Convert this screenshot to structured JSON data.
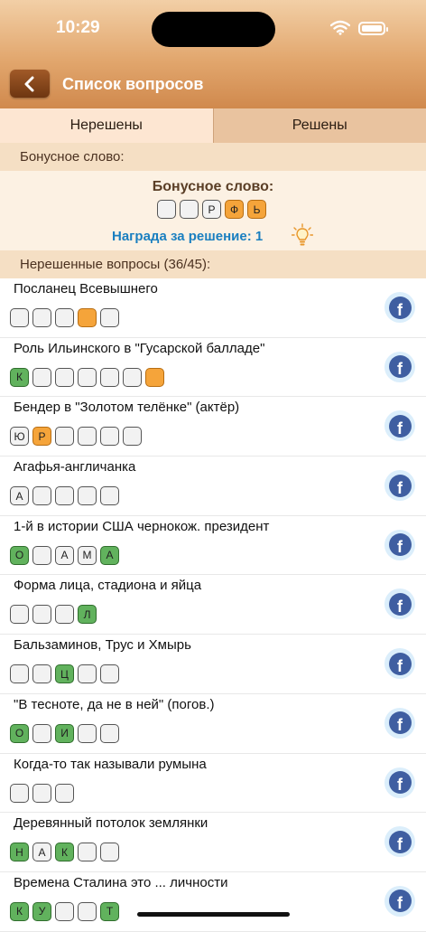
{
  "status": {
    "time": "10:29"
  },
  "header": {
    "title": "Список вопросов"
  },
  "tabs": [
    {
      "label": "Нерешены",
      "active": true
    },
    {
      "label": "Решены",
      "active": false
    }
  ],
  "bonus_section": {
    "header": "Бонусное слово:",
    "title": "Бонусное слово:",
    "letters": [
      {
        "c": "",
        "s": "empty"
      },
      {
        "c": "",
        "s": "empty"
      },
      {
        "c": "Р",
        "s": "empty"
      },
      {
        "c": "Ф",
        "s": "orange"
      },
      {
        "c": "Ь",
        "s": "orange"
      }
    ],
    "reward": "Награда за решение: 1"
  },
  "questions_header": "Нерешенные вопросы (36/45):",
  "questions": [
    {
      "text": "Посланец Всевышнего",
      "letters": [
        {
          "c": "",
          "s": "empty"
        },
        {
          "c": "",
          "s": "empty"
        },
        {
          "c": "",
          "s": "empty"
        },
        {
          "c": "",
          "s": "orange"
        },
        {
          "c": "",
          "s": "empty"
        }
      ]
    },
    {
      "text": "Роль Ильинского в \"Гусарской балладе\"",
      "letters": [
        {
          "c": "К",
          "s": "green"
        },
        {
          "c": "",
          "s": "empty"
        },
        {
          "c": "",
          "s": "empty"
        },
        {
          "c": "",
          "s": "empty"
        },
        {
          "c": "",
          "s": "empty"
        },
        {
          "c": "",
          "s": "empty"
        },
        {
          "c": "",
          "s": "orange"
        }
      ]
    },
    {
      "text": "Бендер в \"Золотом телёнке\" (актёр)",
      "letters": [
        {
          "c": "Ю",
          "s": "empty"
        },
        {
          "c": "Р",
          "s": "orange"
        },
        {
          "c": "",
          "s": "empty"
        },
        {
          "c": "",
          "s": "empty"
        },
        {
          "c": "",
          "s": "empty"
        },
        {
          "c": "",
          "s": "empty"
        }
      ]
    },
    {
      "text": "Агафья-англичанка",
      "letters": [
        {
          "c": "А",
          "s": "empty"
        },
        {
          "c": "",
          "s": "empty"
        },
        {
          "c": "",
          "s": "empty"
        },
        {
          "c": "",
          "s": "empty"
        },
        {
          "c": "",
          "s": "empty"
        }
      ]
    },
    {
      "text": "1-й в истории США чернокож. президент",
      "letters": [
        {
          "c": "О",
          "s": "green"
        },
        {
          "c": "",
          "s": "empty"
        },
        {
          "c": "А",
          "s": "empty"
        },
        {
          "c": "М",
          "s": "empty"
        },
        {
          "c": "А",
          "s": "green"
        }
      ]
    },
    {
      "text": "Форма лица, стадиона и яйца",
      "letters": [
        {
          "c": "",
          "s": "empty"
        },
        {
          "c": "",
          "s": "empty"
        },
        {
          "c": "",
          "s": "empty"
        },
        {
          "c": "Л",
          "s": "green"
        }
      ]
    },
    {
      "text": "Бальзаминов, Трус и Хмырь",
      "letters": [
        {
          "c": "",
          "s": "empty"
        },
        {
          "c": "",
          "s": "empty"
        },
        {
          "c": "Ц",
          "s": "green"
        },
        {
          "c": "",
          "s": "empty"
        },
        {
          "c": "",
          "s": "empty"
        }
      ]
    },
    {
      "text": "\"В тесноте, да не в ней\" (погов.)",
      "letters": [
        {
          "c": "О",
          "s": "green"
        },
        {
          "c": "",
          "s": "empty"
        },
        {
          "c": "И",
          "s": "green"
        },
        {
          "c": "",
          "s": "empty"
        },
        {
          "c": "",
          "s": "empty"
        }
      ]
    },
    {
      "text": "Когда-то так называли румына",
      "letters": [
        {
          "c": "",
          "s": "empty"
        },
        {
          "c": "",
          "s": "empty"
        },
        {
          "c": "",
          "s": "empty"
        }
      ]
    },
    {
      "text": "Деревянный потолок землянки",
      "letters": [
        {
          "c": "Н",
          "s": "green"
        },
        {
          "c": "А",
          "s": "empty"
        },
        {
          "c": "К",
          "s": "green"
        },
        {
          "c": "",
          "s": "empty"
        },
        {
          "c": "",
          "s": "empty"
        }
      ]
    },
    {
      "text": "Времена Сталина это ... личности",
      "letters": [
        {
          "c": "К",
          "s": "green"
        },
        {
          "c": "У",
          "s": "green"
        },
        {
          "c": "",
          "s": "empty"
        },
        {
          "c": "",
          "s": "empty"
        },
        {
          "c": "Т",
          "s": "green"
        }
      ]
    }
  ],
  "share_icon": "facebook-icon",
  "colors": {
    "header_top": "#f2cfa6",
    "header_bottom": "#d0894d",
    "reward": "#1a7fc0",
    "green": "#61b25d",
    "orange": "#f5a43a"
  }
}
